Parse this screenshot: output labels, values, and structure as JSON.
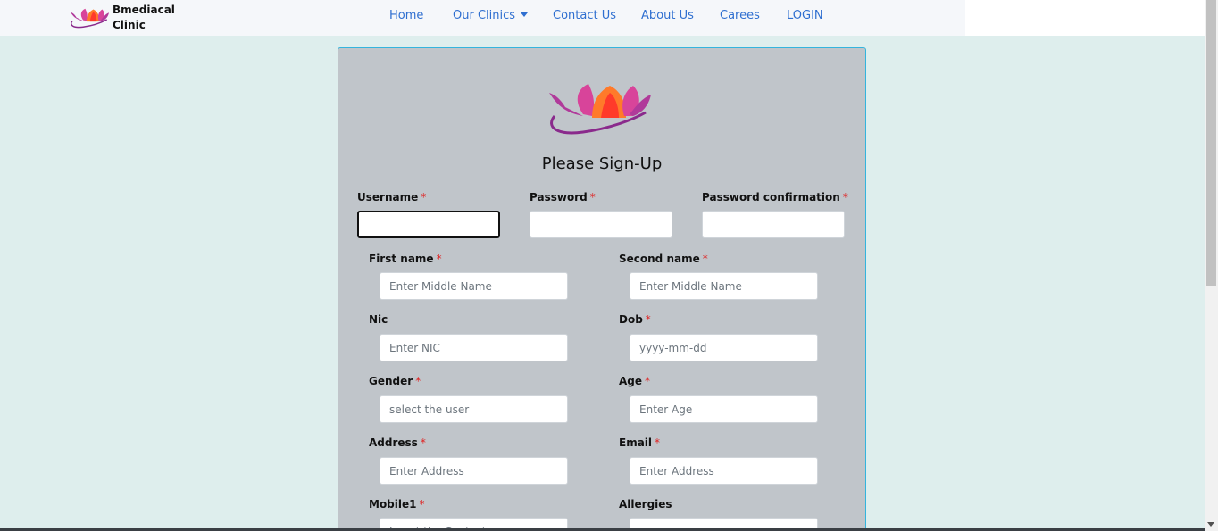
{
  "nav": {
    "brand_name": "Bmediacal Clinic",
    "home": "Home",
    "clinics": "Our Clinics",
    "contact": "Contact Us",
    "about": "About Us",
    "careers": "Carees",
    "login": "LOGIN"
  },
  "form": {
    "title": "Please Sign-Up",
    "required_mark": "*",
    "username": {
      "label": "Username",
      "value": ""
    },
    "password": {
      "label": "Password",
      "value": ""
    },
    "password_confirmation": {
      "label": "Password confirmation",
      "value": ""
    },
    "first_name": {
      "label": "First name",
      "placeholder": "Enter Middle Name"
    },
    "second_name": {
      "label": "Second name",
      "placeholder": "Enter Middle Name"
    },
    "nic": {
      "label": "Nic",
      "placeholder": "Enter NIC"
    },
    "dob": {
      "label": "Dob",
      "placeholder": "yyyy-mm-dd"
    },
    "gender": {
      "label": "Gender",
      "placeholder": "select the user"
    },
    "age": {
      "label": "Age",
      "placeholder": "Enter Age"
    },
    "address": {
      "label": "Address",
      "placeholder": "Enter Address"
    },
    "email": {
      "label": "Email",
      "placeholder": "Enter Address"
    },
    "mobile1": {
      "label": "Mobile1",
      "placeholder": "Insert the Contact"
    },
    "allergies": {
      "label": "Allergies",
      "placeholder": ""
    }
  },
  "colors": {
    "page_bg": "#deeeed",
    "card_bg": "#c0c5ca",
    "card_border": "#34b4dd",
    "nav_link": "#2f6fd0",
    "required": "#e02020"
  },
  "icons": {
    "logo": "lotus-logo-icon",
    "dropdown": "caret-down-icon"
  }
}
